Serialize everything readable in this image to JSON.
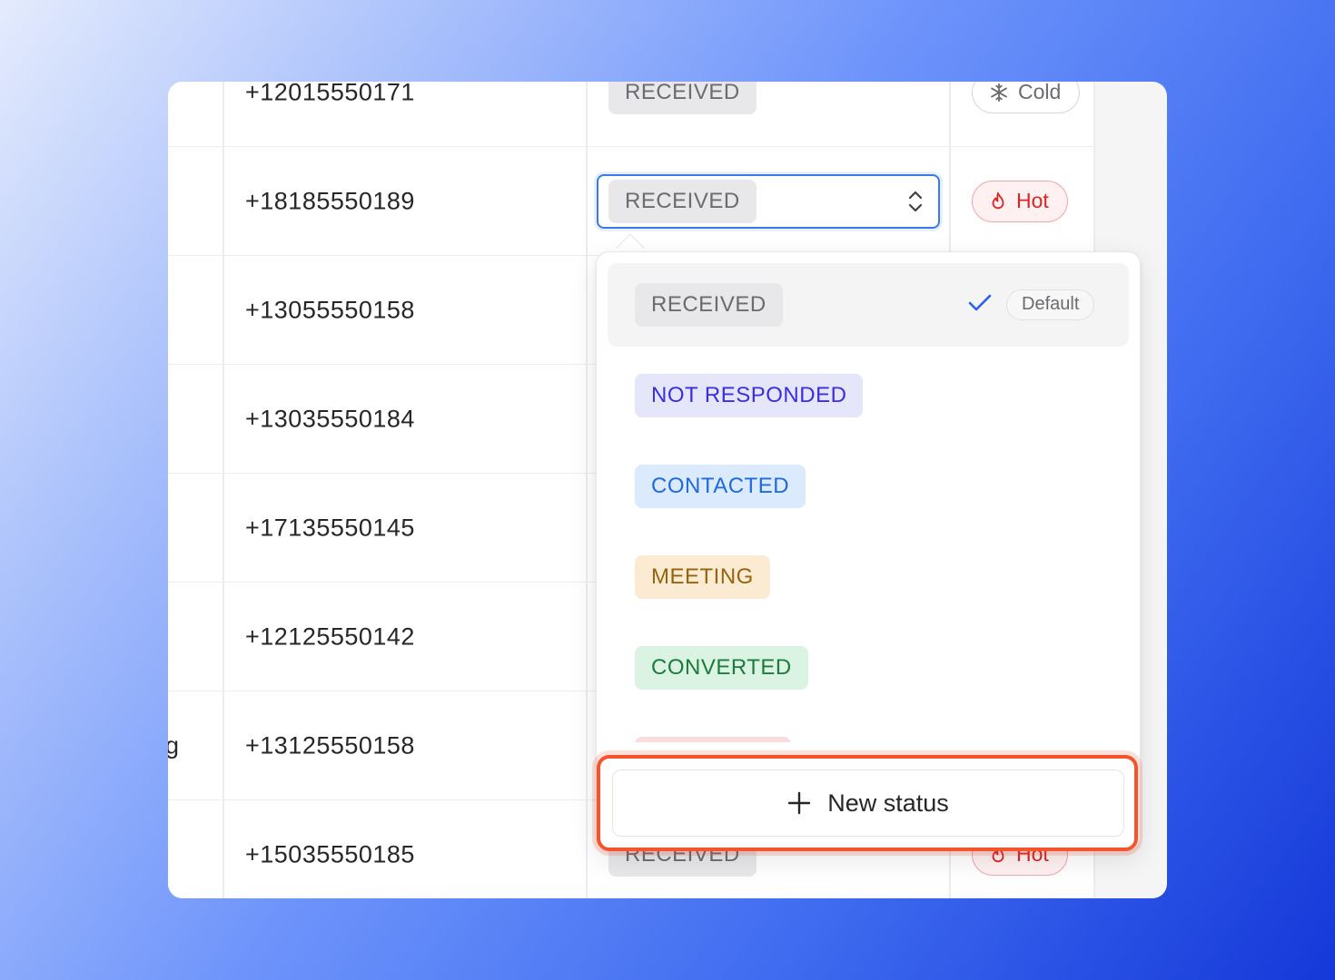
{
  "rows": [
    {
      "prev": "",
      "phone": "+12015550171",
      "status": "RECEIVED",
      "temp": "Cold",
      "temp_type": "cold"
    },
    {
      "prev": "",
      "phone": "+18185550189",
      "status": "RECEIVED",
      "temp": "Hot",
      "temp_type": "hot"
    },
    {
      "prev": "",
      "phone": "+13055550158",
      "status": "",
      "temp": "",
      "temp_type": ""
    },
    {
      "prev": "",
      "phone": "+13035550184",
      "status": "",
      "temp": "",
      "temp_type": ""
    },
    {
      "prev": "",
      "phone": "+17135550145",
      "status": "",
      "temp": "",
      "temp_type": ""
    },
    {
      "prev": "",
      "phone": "+12125550142",
      "status": "",
      "temp": "",
      "temp_type": ""
    },
    {
      "prev": "g",
      "phone": "+13125550158",
      "status": "",
      "temp": "",
      "temp_type": ""
    },
    {
      "prev": "",
      "phone": "+15035550185",
      "status": "RECEIVED",
      "temp": "Hot",
      "temp_type": "hot"
    }
  ],
  "select": {
    "value": "RECEIVED",
    "icon": "chevron-up-down-icon"
  },
  "dropdown": {
    "options": [
      {
        "label": "RECEIVED",
        "color": "#6b6b70",
        "bg": "#e8e8ea",
        "selected": true,
        "badge": "Default"
      },
      {
        "label": "NOT RESPONDED",
        "color": "#3b2ee0",
        "bg": "#e6e6fb"
      },
      {
        "label": "CONTACTED",
        "color": "#1e6ae0",
        "bg": "#dceafd"
      },
      {
        "label": "MEETING",
        "color": "#96640e",
        "bg": "#fbebd3"
      },
      {
        "label": "CONVERTED",
        "color": "#1c7c3d",
        "bg": "#daf3e2"
      }
    ],
    "new_status_label": "New status",
    "highlight_color": "#f4532c"
  }
}
